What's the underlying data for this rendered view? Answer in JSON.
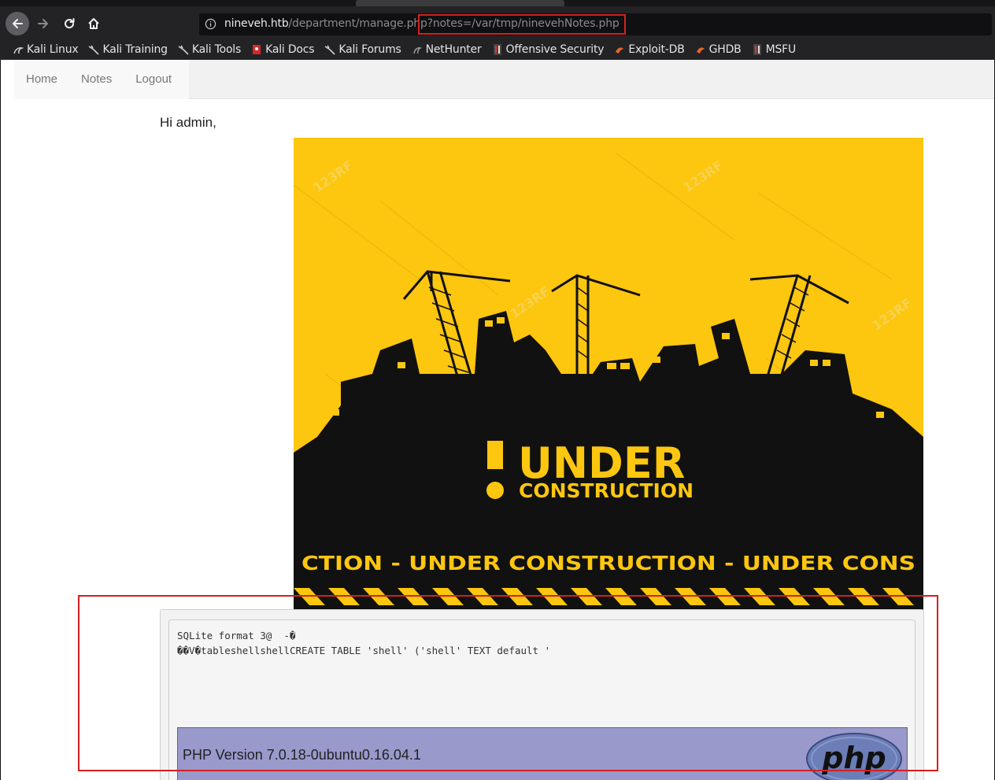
{
  "browser": {
    "url": {
      "host": "nineveh.htb",
      "path": "/department/manage.php",
      "query": "?notes=/var/tmp/ninevehNotes.php"
    },
    "bookmarks": [
      {
        "label": "Kali Linux",
        "icon": "kali-dragon-icon"
      },
      {
        "label": "Kali Training",
        "icon": "kali-dragon-icon"
      },
      {
        "label": "Kali Tools",
        "icon": "kali-dragon-icon"
      },
      {
        "label": "Kali Docs",
        "icon": "kali-docs-icon"
      },
      {
        "label": "Kali Forums",
        "icon": "kali-dragon-icon"
      },
      {
        "label": "NetHunter",
        "icon": "nethunter-icon"
      },
      {
        "label": "Offensive Security",
        "icon": "offsec-icon"
      },
      {
        "label": "Exploit-DB",
        "icon": "exploitdb-icon"
      },
      {
        "label": "GHDB",
        "icon": "ghdb-icon"
      },
      {
        "label": "MSFU",
        "icon": "offsec-icon"
      }
    ]
  },
  "site": {
    "nav": [
      {
        "label": "Home"
      },
      {
        "label": "Notes"
      },
      {
        "label": "Logout"
      }
    ],
    "greeting": "Hi admin,",
    "banner": {
      "headline": "UNDER",
      "subline": "CONSTRUCTION",
      "ticker": "CTION - UNDER  CONSTRUCTION - UNDER  CONS",
      "watermark": "123RF"
    },
    "file_output": {
      "line1": "SQLite format 3@  -�",
      "line2": "��V�tableshellshellCREATE TABLE 'shell' ('shell' TEXT default '"
    },
    "phpinfo": {
      "version": "PHP Version 7.0.18-0ubuntu0.16.04.1",
      "logo_text": "php"
    }
  },
  "colors": {
    "highlight": "#d32020",
    "banner_yellow": "#fdc60f",
    "php_header": "#9999cc"
  }
}
